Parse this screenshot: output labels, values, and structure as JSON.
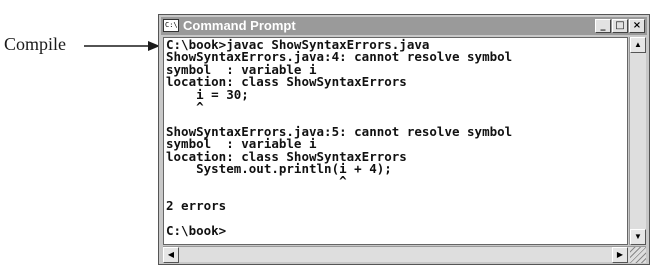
{
  "annotation": {
    "label": "Compile"
  },
  "window": {
    "title": "Command Prompt",
    "icon_text": "C:\\",
    "buttons": {
      "minimize_icon": "minimize-icon",
      "maximize_icon": "maximize-icon",
      "close_icon": "close-icon"
    }
  },
  "console": {
    "lines": [
      "C:\\book>javac ShowSyntaxErrors.java",
      "ShowSyntaxErrors.java:4: cannot resolve symbol",
      "symbol  : variable i",
      "location: class ShowSyntaxErrors",
      "    i = 30;",
      "    ^",
      "",
      "ShowSyntaxErrors.java:5: cannot resolve symbol",
      "symbol  : variable i",
      "location: class ShowSyntaxErrors",
      "    System.out.println(i + 4);",
      "                       ^",
      "",
      "2 errors",
      "",
      "C:\\book>"
    ]
  },
  "colors": {
    "titlebar": "#9a9a9a",
    "console_bg": "#ffffff",
    "console_text": "#111111"
  }
}
